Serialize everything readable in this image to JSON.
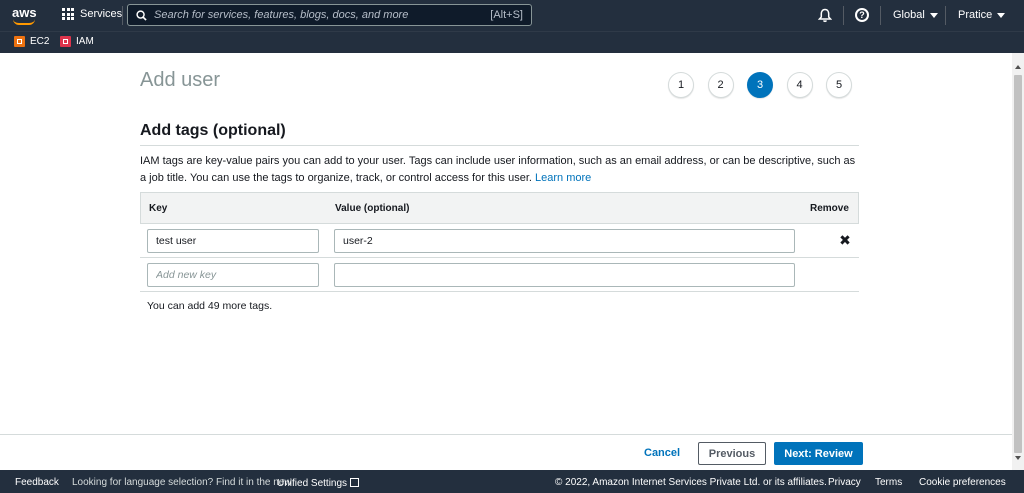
{
  "topnav": {
    "logo_text": "aws",
    "services_label": "Services",
    "search_placeholder": "Search for services, features, blogs, docs, and more",
    "search_shortcut": "[Alt+S]",
    "region_label": "Global",
    "account_label": "Pratice"
  },
  "favorites": [
    {
      "label": "EC2",
      "color": "#ec7211"
    },
    {
      "label": "IAM",
      "color": "#dd344c"
    }
  ],
  "page": {
    "title": "Add user",
    "steps": [
      "1",
      "2",
      "3",
      "4",
      "5"
    ],
    "active_step": "3",
    "section_title": "Add tags (optional)",
    "description": "IAM tags are key-value pairs you can add to your user. Tags can include user information, such as an email address, or can be descriptive, such as a job title. You can use the tags to organize, track, or control access for this user.",
    "learn_more": "Learn more"
  },
  "table": {
    "headers": {
      "key": "Key",
      "value": "Value (optional)",
      "remove": "Remove"
    },
    "rows": [
      {
        "key": "test user",
        "value": "user-2"
      }
    ],
    "new_row": {
      "key_placeholder": "Add new key",
      "value": ""
    },
    "remaining_note": "You can add 49 more tags."
  },
  "actions": {
    "cancel": "Cancel",
    "previous": "Previous",
    "next": "Next: Review"
  },
  "footer": {
    "feedback": "Feedback",
    "language_text": "Looking for language selection? Find it in the new",
    "unified_settings": "Unified Settings",
    "copyright": "© 2022, Amazon Internet Services Private Ltd. or its affiliates.",
    "privacy": "Privacy",
    "terms": "Terms",
    "cookies": "Cookie preferences"
  },
  "colors": {
    "nav_bg": "#232f3e",
    "primary": "#0073bb",
    "link": "#0073bb",
    "ec2": "#ec7211",
    "iam": "#dd344c"
  }
}
